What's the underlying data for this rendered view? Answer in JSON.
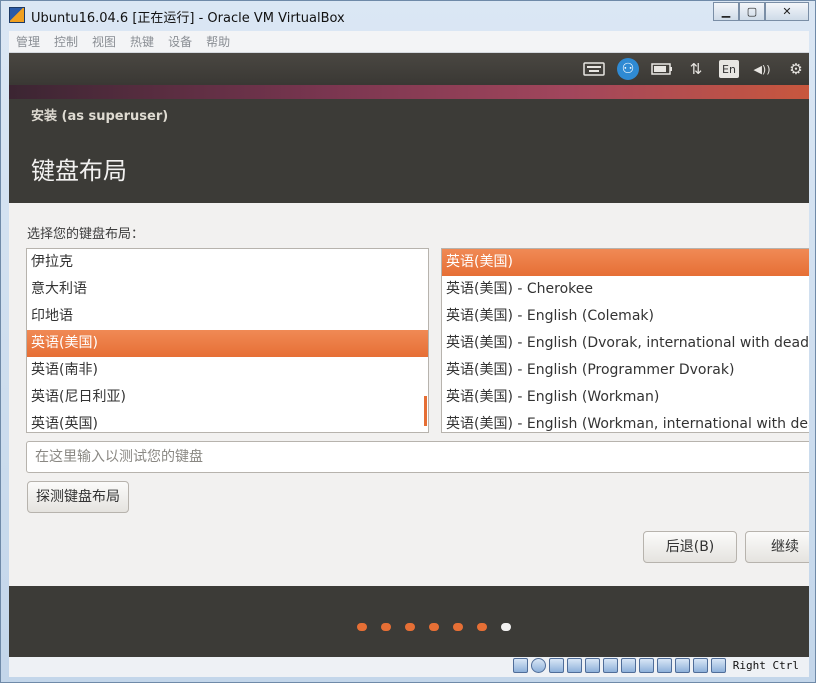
{
  "window": {
    "title": "Ubuntu16.04.6 [正在运行] - Oracle VM VirtualBox",
    "buttons": {
      "minimize": "▁",
      "maximize": "▢",
      "close": "✕"
    }
  },
  "menubar": [
    "管理",
    "控制",
    "视图",
    "热键",
    "设备",
    "帮助"
  ],
  "panel": {
    "language": "En",
    "accessibility_symbol": "⚇",
    "network_symbol": "⇅",
    "volume_symbol": "◀))",
    "gear_symbol": "⚙"
  },
  "installer": {
    "title": "安装 (as superuser)",
    "heading": "键盘布局",
    "prompt": "选择您的键盘布局：",
    "layouts": [
      "伊拉克",
      "意大利语",
      "印地语",
      "英语(美国)",
      "英语(南非)",
      "英语(尼日利亚)",
      "英语(英国)"
    ],
    "selected_layout_index": 3,
    "variants": [
      "英语(美国)",
      "英语(美国) - Cherokee",
      "英语(美国) - English (Colemak)",
      "英语(美国) - English (Dvorak, international with dead k",
      "英语(美国) - English (Programmer Dvorak)",
      "英语(美国) - English (Workman)",
      "英语(美国) - English (Workman, international with dea"
    ],
    "selected_variant_index": 0,
    "test_input_placeholder": "在这里输入以测试您的键盘",
    "detect_button": "探测键盘布局",
    "back_button": "后退(B)",
    "next_button": "继续",
    "progress": {
      "total_steps": 7,
      "current_step": 7
    }
  },
  "statusbar": {
    "host_key": "Right Ctrl"
  },
  "colors": {
    "accent": "#e66f35",
    "panel": "#3c3b37",
    "body": "#f2f1f0"
  }
}
